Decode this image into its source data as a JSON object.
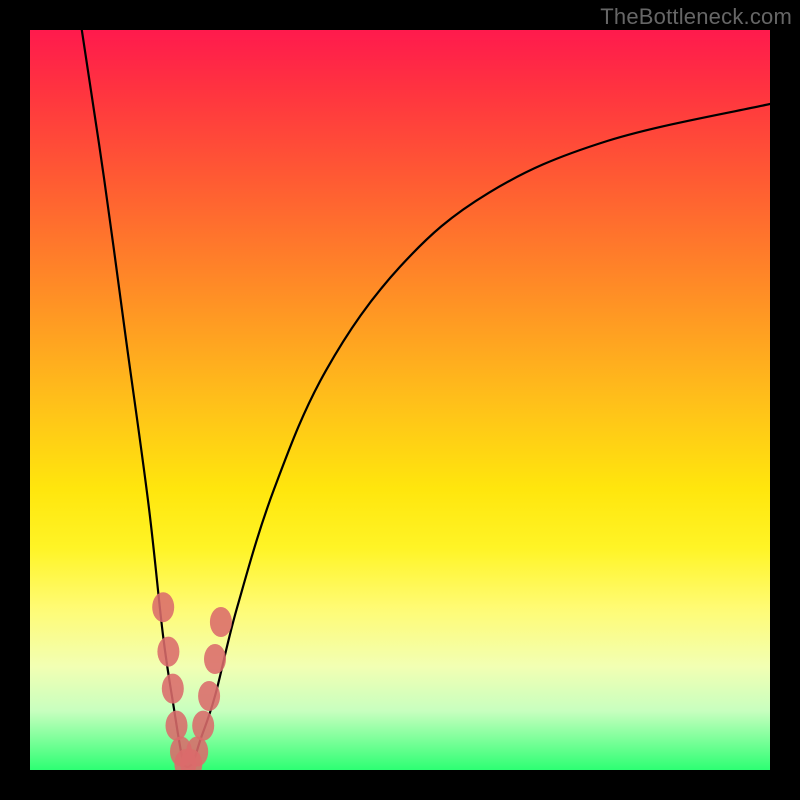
{
  "watermark": "TheBottleneck.com",
  "chart_data": {
    "type": "line",
    "title": "",
    "xlabel": "",
    "ylabel": "",
    "xlim": [
      0,
      100
    ],
    "ylim": [
      0,
      100
    ],
    "series": [
      {
        "name": "bottleneck-curve",
        "x": [
          7,
          10,
          13,
          16,
          18,
          19.5,
          20.5,
          21,
          22,
          23,
          25,
          28,
          33,
          40,
          50,
          62,
          78,
          100
        ],
        "values": [
          100,
          80,
          58,
          36,
          18,
          8,
          2,
          0.5,
          1,
          4,
          10,
          22,
          38,
          54,
          68,
          78,
          85,
          90
        ]
      }
    ],
    "markers": {
      "name": "highlight-points",
      "color": "#db6b6b",
      "points": [
        {
          "x": 18.0,
          "y": 22
        },
        {
          "x": 18.7,
          "y": 16
        },
        {
          "x": 19.3,
          "y": 11
        },
        {
          "x": 19.8,
          "y": 6
        },
        {
          "x": 20.4,
          "y": 2.5
        },
        {
          "x": 21.0,
          "y": 0.8
        },
        {
          "x": 21.8,
          "y": 0.8
        },
        {
          "x": 22.6,
          "y": 2.5
        },
        {
          "x": 23.4,
          "y": 6
        },
        {
          "x": 24.2,
          "y": 10
        },
        {
          "x": 25.0,
          "y": 15
        },
        {
          "x": 25.8,
          "y": 20
        }
      ]
    },
    "background_gradient": {
      "top": "#ff1a4d",
      "bottom": "#2dff73"
    }
  }
}
